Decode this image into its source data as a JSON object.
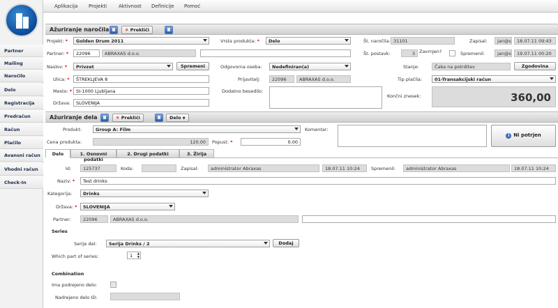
{
  "menu": [
    "Aplikacija",
    "Projekti",
    "Aktivnost",
    "Definicije",
    "Pomoć"
  ],
  "sidebar": [
    "Partner",
    "Mailing",
    "Naročilo",
    "Delo",
    "Registracija",
    "Predračun",
    "Račun",
    "Plačilo",
    "Avansni račun",
    "Vhodni račun",
    "Check-In"
  ],
  "order": {
    "title": "Ažuriranje naročila",
    "cancel": "Prekliči",
    "projekt_label": "Projekt:",
    "projekt": "Golden Drum 2011",
    "vrsta_label": "Vrsta produkta:",
    "vrsta": "Delo",
    "st_narocila_label": "Št. naročila:",
    "st_narocila": "31101",
    "zapisal_label": "Zapisal:",
    "zapisal_user": "jan@s",
    "zapisal_date": "18.07.11 09:43",
    "partner_label": "Partner:",
    "partner_id": "22096",
    "partner_name": "ABRAXAS d.o.o.",
    "st_postavk_label": "Št. postavk:",
    "st_postavk": "3",
    "zavrnjen_label": "Zavrnjen?",
    "spremenil_label": "Spremenil:",
    "spremenil_user": "jan@s",
    "spremenil_date": "19.07.11 00:20",
    "naslov_label": "Naslov:",
    "naslov": "Privzet",
    "spremeni": "Spremeni",
    "odgovorna_label": "Odgovorna oseba:",
    "odgovorna": "Nedefiniran(a)",
    "stanje_label": "Stanje:",
    "stanje": "Čaka na potrditev",
    "zgodovina": "Zgodovina",
    "ulica_label": "Ulica:",
    "ulica": "ŠTREKLJEVA 8",
    "prijavitelj_label": "Prijavitelj:",
    "prijavitelj_id": "22096",
    "prijavitelj_name": "ABRAXAS d.o.o.",
    "tip_placila_label": "Tip plačila:",
    "tip_placila": "01-Transakcijski račun",
    "mesto_label": "Mesto:",
    "mesto": "SI-1000 Ljubljana",
    "dodatno_label": "Dodatno besedilo:",
    "koncni_label": "Končni znesek:",
    "koncni": "360,00",
    "drzava_label": "Država:",
    "drzava": "SLOVENIJA"
  },
  "work": {
    "title": "Ažuriranje dela",
    "cancel": "Prekliči",
    "delo_btn": "Delo",
    "produkt_label": "Produkt:",
    "produkt": "Group A: Film",
    "komentar_label": "Komentar:",
    "ni_potrjen": "Ni potrjen",
    "cena_label": "Cena produkta:",
    "cena": "120.00",
    "popust_label": "Popust:",
    "popust": "0.00",
    "tabs": [
      "Delo",
      "1. Osnovni podatki",
      "2. Drugi podatki",
      "3. Žirija"
    ],
    "id_label": "Id:",
    "id": "125737",
    "koda_label": "Koda:",
    "zapisal_label": "Zapisal:",
    "zapisal": "administrator Abraxas",
    "zapisal_date": "18.07.11 10:24",
    "spremenil_label": "Spremenil:",
    "spremenil": "administrator Abraxas",
    "spremenil_date": "18.07.11 10:24",
    "naziv_label": "Naziv:",
    "naziv": "Test drinks",
    "kategorija_label": "Kategorija:",
    "kategorija": "Drinks",
    "drzava_label": "Država:",
    "drzava": "SLOVENIJA",
    "partner_label": "Partner:",
    "partner_id": "22096",
    "partner_name": "ABRAXAS d.o.o.",
    "series_heading": "Series",
    "serije_label": "Serije del:",
    "serije": "Serija Drinks / 2",
    "dodaj": "Dodaj",
    "which_label": "Which part of series:",
    "which": "1",
    "combination_heading": "Combination",
    "ima_label": "Ima podrejeno delo:",
    "nadrejeno_label": "Nadrejeno delo ID:"
  }
}
